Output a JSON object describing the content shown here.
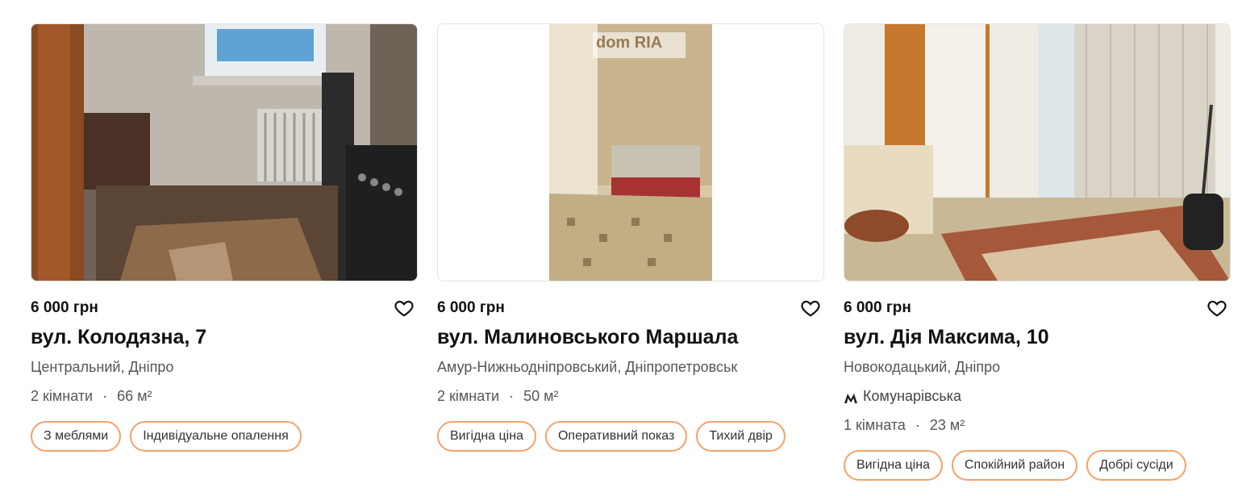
{
  "listings": [
    {
      "price": "6 000 грн",
      "street": "вул. Колодязна, 7",
      "district": "Центральний, Дніпро",
      "rooms": "2 кімнати",
      "area": "66 м²",
      "tags": [
        "З меблями",
        "Індивідуальне опалення"
      ],
      "favorite_icon": "heart-outline-icon"
    },
    {
      "price": "6 000 грн",
      "street": "вул. Малиновського Маршала",
      "district": "Амур-Нижньодніпровський, Дніпропетровськ",
      "rooms": "2 кімнати",
      "area": "50 м²",
      "tags": [
        "Вигідна ціна",
        "Оперативний показ",
        "Тихий двір"
      ],
      "photo_watermark": "dom RIA",
      "favorite_icon": "heart-outline-icon"
    },
    {
      "price": "6 000 грн",
      "street": "вул. Дія Максима, 10",
      "district": "Новокодацький, Дніпро",
      "metro": "Комунарівська",
      "rooms": "1 кімната",
      "area": "23 м²",
      "tags": [
        "Вигідна ціна",
        "Спокійний район",
        "Добрі сусіди"
      ],
      "favorite_icon": "heart-outline-icon"
    }
  ],
  "colors": {
    "tag_border": "#f5a26a",
    "text_main": "#111111",
    "text_muted": "#555555"
  }
}
